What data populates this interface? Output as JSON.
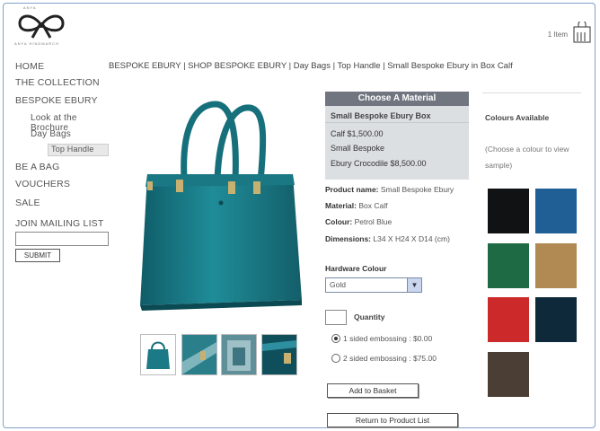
{
  "header": {
    "logo_top_text": "ANYA",
    "logo_bottom_text": "ANYA HINDMARCH",
    "cart_text": "1 Item"
  },
  "nav": {
    "items": [
      "HOME",
      "THE COLLECTION",
      "BESPOKE EBURY",
      "Look at the Brochure",
      "Day Bags",
      "Top Handle",
      "BE A BAG",
      "VOUCHERS",
      "SALE"
    ],
    "mailing_label": "JOIN MAILING LIST",
    "mailing_value": "",
    "submit_label": "SUBMIT"
  },
  "breadcrumb": "BESPOKE EBURY | SHOP BESPOKE EBURY | Day Bags  | Top Handle | Small Bespoke Ebury in Box Calf",
  "material": {
    "heading": "Choose A Material",
    "product_title": "Small Bespoke Ebury Box",
    "lines": [
      "Calf $1,500.00",
      "Small Bespoke",
      "Ebury Crocodile $8,500.00"
    ]
  },
  "product": {
    "name_label": "Product name:",
    "name_value": "Small Bespoke Ebury",
    "material_label": "Material:",
    "material_value": "Box Calf",
    "colour_label": "Colour:",
    "colour_value": "Petrol Blue",
    "dimensions_label": "Dimensions:",
    "dimensions_value": "L34 X H24 X D14 (cm)"
  },
  "hardware": {
    "label": "Hardware Colour",
    "selected": "Gold"
  },
  "quantity": {
    "label": "Quantity",
    "value": ""
  },
  "embossing": {
    "options": [
      "1 sided embossing : $0.00",
      "2 sided embossing : $75.00"
    ],
    "selected_index": 0
  },
  "buttons": {
    "add_to_basket": "Add to Basket",
    "return_to_list": "Return to Product List"
  },
  "colours": {
    "title": "Colours Available",
    "hint": "(Choose a colour to view sample)",
    "swatches": [
      "#111214",
      "#1f5f95",
      "#1d6a45",
      "#b08a52",
      "#cc2a2a",
      "#0e2a3a",
      "#4a3e35"
    ]
  },
  "colors": {
    "bag": "#1b7a86",
    "panel_header": "#707580",
    "panel_bg": "#dcdfe2"
  }
}
